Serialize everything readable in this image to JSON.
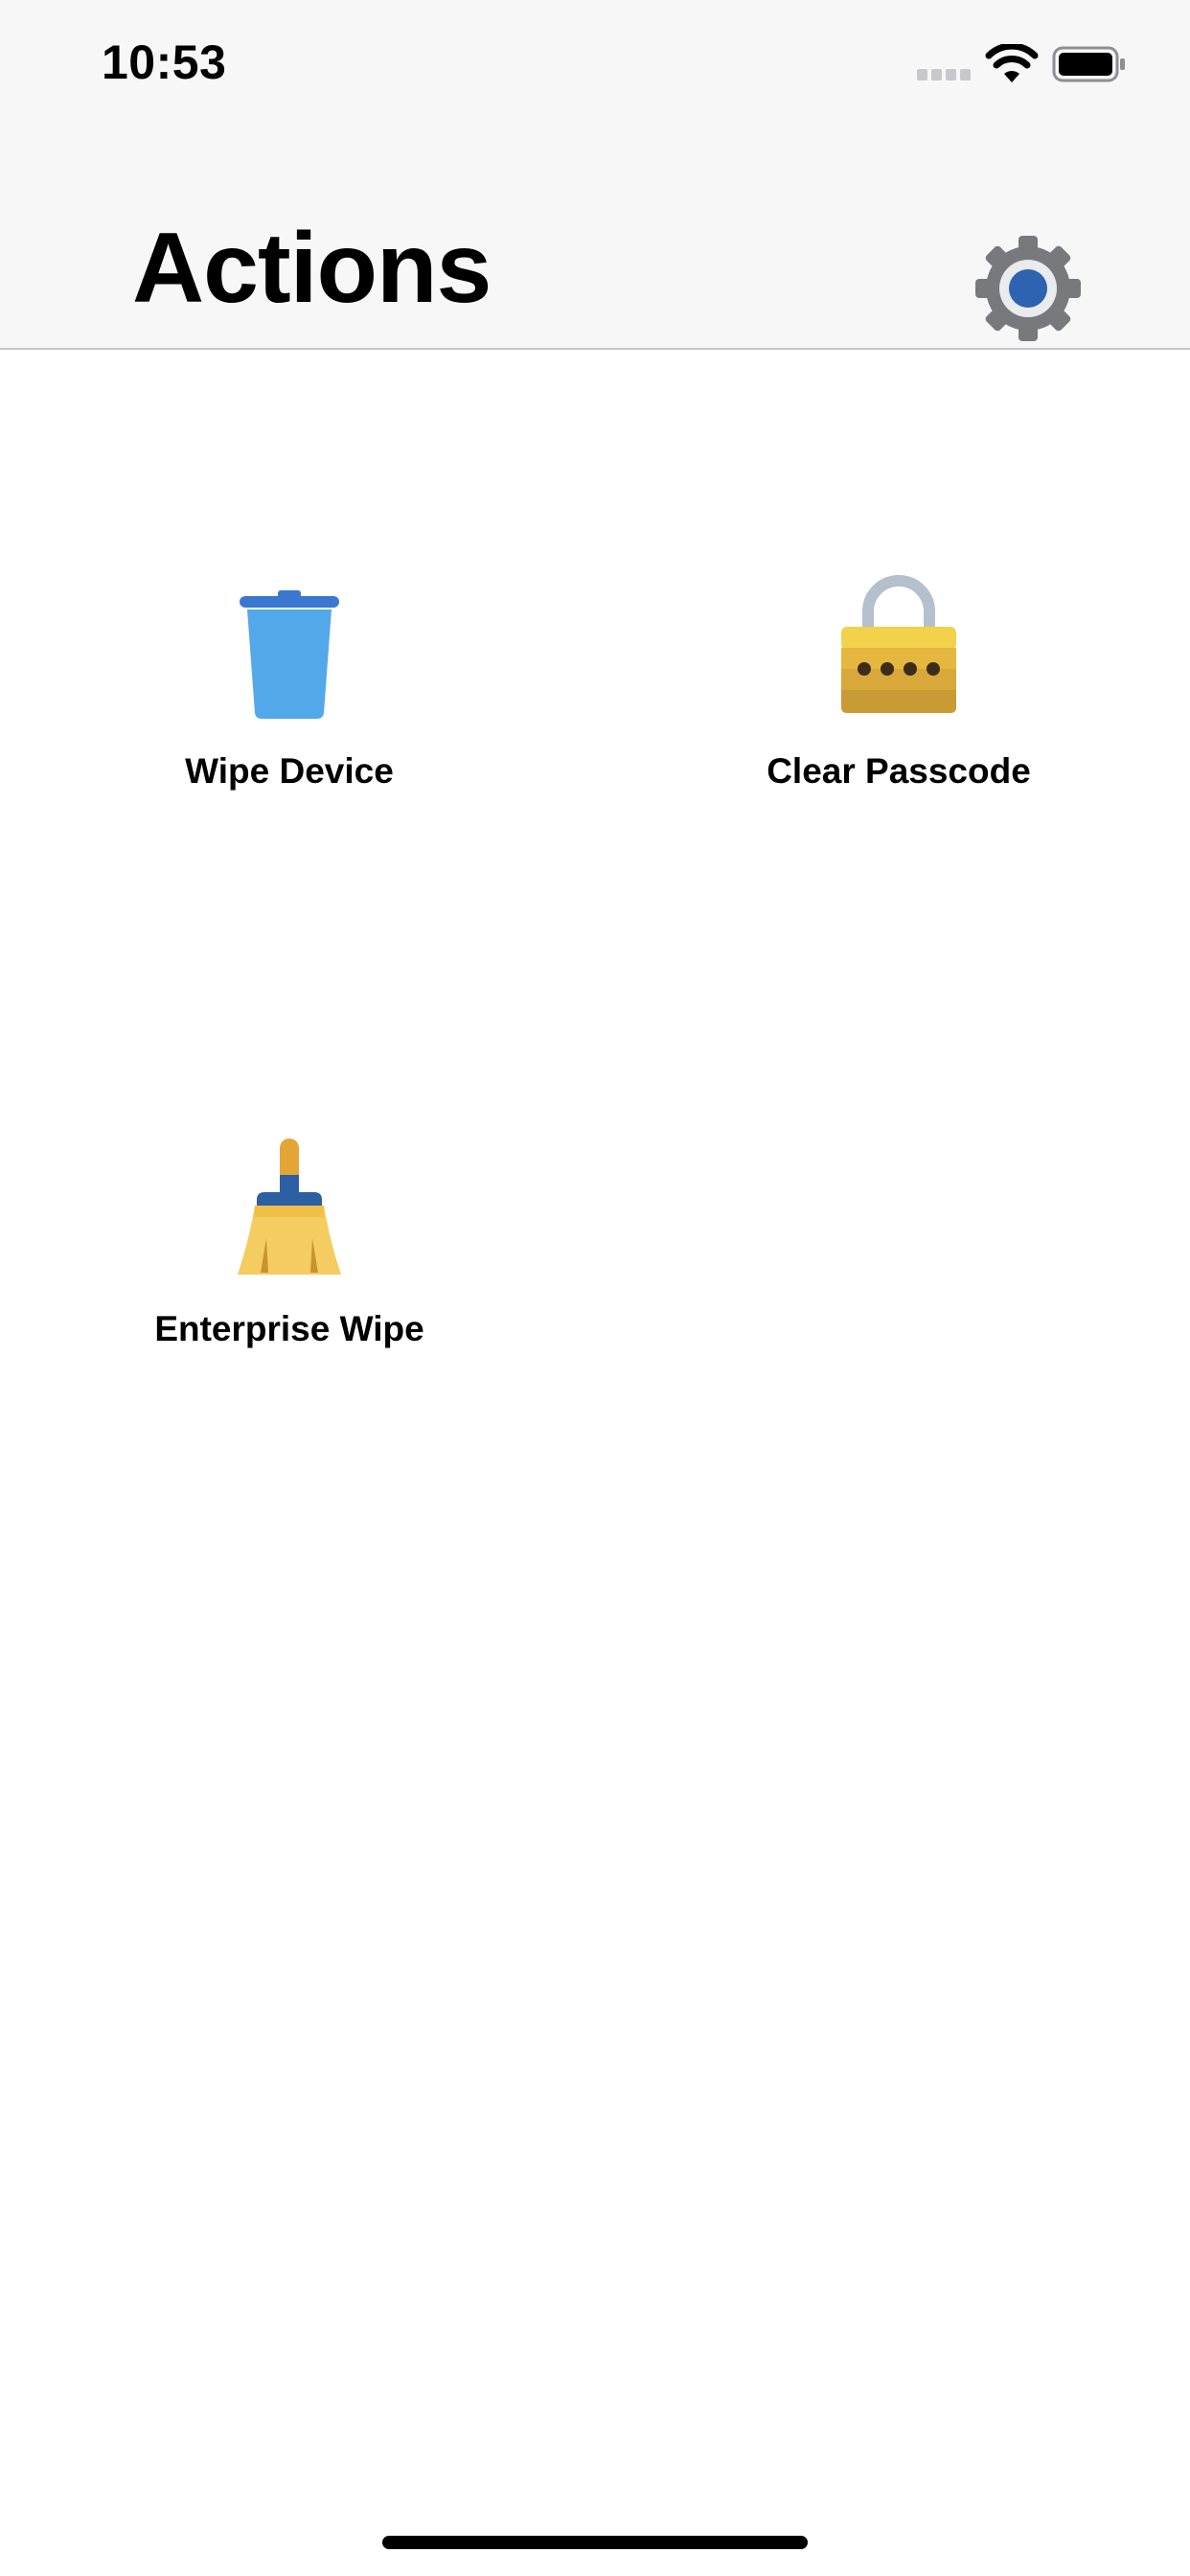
{
  "status_bar": {
    "time": "10:53"
  },
  "header": {
    "title": "Actions",
    "settings_icon": "gear-icon",
    "background": "#f7f7f7"
  },
  "actions": [
    {
      "label": "Wipe Device",
      "icon": "trash-can-icon",
      "color": "#4a9fe5"
    },
    {
      "label": "Clear Passcode",
      "icon": "padlock-icon",
      "color": "#e8bf3a"
    },
    {
      "label": "Enterprise Wipe",
      "icon": "broom-icon",
      "color": "#f1c24f"
    }
  ]
}
